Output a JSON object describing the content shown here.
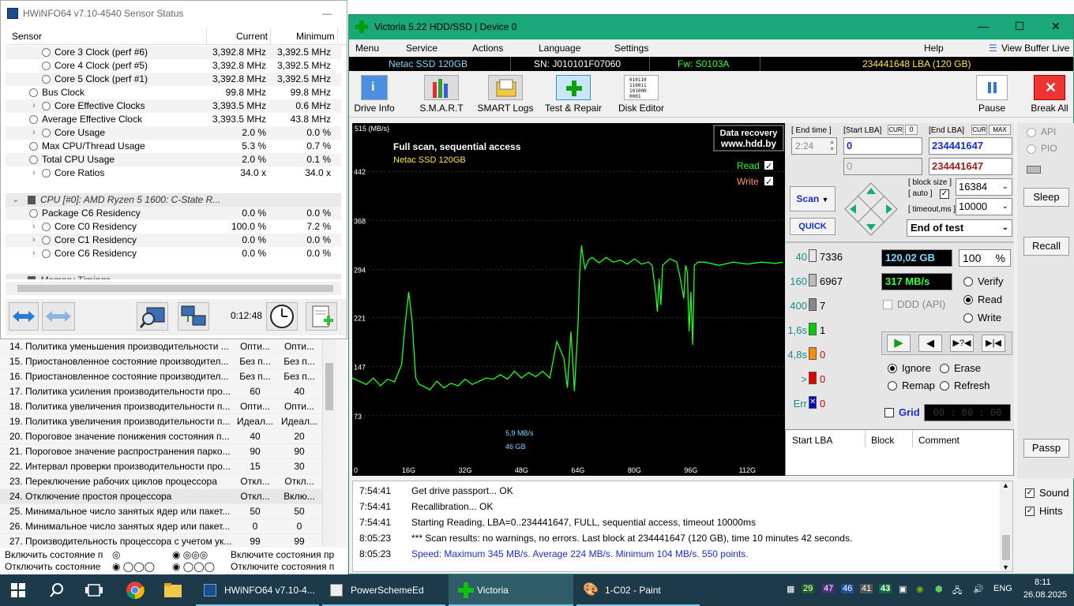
{
  "pse": {
    "rows": [
      {
        "name": "14. Политика уменьшения производительности ...",
        "a": "Опти...",
        "b": "Опти..."
      },
      {
        "name": "15. Приостановленное состояние производител...",
        "a": "Без п...",
        "b": "Без п..."
      },
      {
        "name": "16. Приостановленное состояние производител...",
        "a": "Без п...",
        "b": "Без п..."
      },
      {
        "name": "17. Политика усиления производительности про...",
        "a": "60",
        "b": "40"
      },
      {
        "name": "18. Политика увеличения производительности п...",
        "a": "Опти...",
        "b": "Опти..."
      },
      {
        "name": "19. Политика увеличения производительности п...",
        "a": "Идеал...",
        "b": "Идеал..."
      },
      {
        "name": "20. Пороговое значение понижения состояния п...",
        "a": "40",
        "b": "20"
      },
      {
        "name": "21. Пороговое значение распространения парко...",
        "a": "90",
        "b": "90"
      },
      {
        "name": "22. Интервал проверки производительности про...",
        "a": "15",
        "b": "30"
      },
      {
        "name": "23. Переключение рабочих циклов процессора",
        "a": "Откл...",
        "b": "Откл..."
      },
      {
        "name": "24. Отключение простоя процессора",
        "a": "Откл...",
        "b": "Вклю..."
      },
      {
        "name": "25. Минимальное число занятых ядер или пакет...",
        "a": "50",
        "b": "50"
      },
      {
        "name": "26. Минимальное число занятых ядер или пакет...",
        "a": "0",
        "b": "0"
      },
      {
        "name": "27. Производительность процессора с учетом ук...",
        "a": "99",
        "b": "99"
      }
    ],
    "bottom1_left": "Включить состояние п",
    "bottom1_right": "Включите состояния пр",
    "bottom2_left": "Отключить состояние",
    "bottom2_right": "Отключите состояния п"
  },
  "hwinfo": {
    "title": "HWiNFO64 v7.10-4540 Sensor Status",
    "columns": {
      "sensor": "Sensor",
      "current": "Current",
      "minimum": "Minimum"
    },
    "rows": [
      {
        "label": "Core 3 Clock (perf #6)",
        "cur": "3,392.8 MHz",
        "min": "3,392.5 MHz",
        "indent": 2,
        "exp": false
      },
      {
        "label": "Core 4 Clock (perf #5)",
        "cur": "3,392.8 MHz",
        "min": "3,392.5 MHz",
        "indent": 2,
        "exp": false
      },
      {
        "label": "Core 5 Clock (perf #1)",
        "cur": "3,392.8 MHz",
        "min": "3,392.5 MHz",
        "indent": 2,
        "exp": false
      },
      {
        "label": "Bus Clock",
        "cur": "99.8 MHz",
        "min": "99.8 MHz",
        "indent": 1,
        "exp": false
      },
      {
        "label": "Core Effective Clocks",
        "cur": "3,393.5 MHz",
        "min": "0.6 MHz",
        "indent": 2,
        "exp": true
      },
      {
        "label": "Average Effective Clock",
        "cur": "3,393.5 MHz",
        "min": "43.8 MHz",
        "indent": 1,
        "exp": false
      },
      {
        "label": "Core Usage",
        "cur": "2.0 %",
        "min": "0.0 %",
        "indent": 2,
        "exp": true
      },
      {
        "label": "Max CPU/Thread Usage",
        "cur": "5.3 %",
        "min": "0.7 %",
        "indent": 1,
        "exp": false
      },
      {
        "label": "Total CPU Usage",
        "cur": "2.0 %",
        "min": "0.1 %",
        "indent": 1,
        "exp": false
      },
      {
        "label": "Core Ratios",
        "cur": "34.0 x",
        "min": "34.0 x",
        "indent": 2,
        "exp": true
      },
      {
        "label": "",
        "cur": "",
        "min": "",
        "indent": 0,
        "exp": false,
        "blank": true
      },
      {
        "label": "CPU [#0]: AMD Ryzen 5 1600: C-State R...",
        "cur": "",
        "min": "",
        "indent": 0,
        "exp": false,
        "group": true
      },
      {
        "label": "Package C6 Residency",
        "cur": "0.0 %",
        "min": "0.0 %",
        "indent": 1,
        "exp": false
      },
      {
        "label": "Core C0 Residency",
        "cur": "100.0 %",
        "min": "7.2 %",
        "indent": 2,
        "exp": true
      },
      {
        "label": "Core C1 Residency",
        "cur": "0.0 %",
        "min": "0.0 %",
        "indent": 2,
        "exp": true
      },
      {
        "label": "Core C6 Residency",
        "cur": "0.0 %",
        "min": "0.0 %",
        "indent": 2,
        "exp": true
      },
      {
        "label": "",
        "cur": "",
        "min": "",
        "indent": 0,
        "exp": false,
        "blank": true
      },
      {
        "label": "Memory Timings",
        "cur": "",
        "min": "",
        "indent": 0,
        "exp": false,
        "group": true
      }
    ],
    "timer": "0:12:48"
  },
  "victoria": {
    "title": "Victoria 5.22 HDD/SSD | Device 0",
    "menu": [
      "Menu",
      "Service",
      "Actions",
      "Language",
      "Settings",
      "Help"
    ],
    "view_buffer": "View Buffer Live",
    "info": {
      "model": "Netac SSD 120GB",
      "sn": "SN: J010101F07060",
      "fw": "Fw: S0103A",
      "lba": "234441648 LBA (120 GB)"
    },
    "tools": [
      "Drive Info",
      "S.M.A.R.T",
      "SMART Logs",
      "Test & Repair",
      "Disk Editor"
    ],
    "pause": "Pause",
    "break_all": "Break All",
    "graph": {
      "watermark1": "Data recovery",
      "watermark2": "www.hdd.by",
      "title": "Full scan, sequential access",
      "model": "Netac SSD 120GB",
      "read": "Read",
      "write": "Write",
      "ylabel": "515 (MB/s)",
      "cursor_speed": "5,9 MB/s",
      "cursor_pos": "46 GB"
    },
    "panel": {
      "end_time_label": "[ End time ]",
      "end_time": "2:24",
      "start_lba_label": "[Start LBA]",
      "cur": "CUR",
      "cur_val": "0",
      "end_lba_label": "[End LBA]",
      "max": "MAX",
      "start_lba": "0",
      "end_lba": "234441647",
      "start_lba2": "0",
      "end_lba2": "234441647",
      "scan": "Scan",
      "quick": "QUICK",
      "block_size_label": "[ block size ]",
      "auto_label": "[ auto ]",
      "block_size": "16384",
      "timeout_label": "[ timeout,ms ]",
      "timeout": "10000",
      "end_action": "End of test",
      "capacity": "120,02 GB",
      "percent": "100",
      "pct_sign": "%",
      "speed": "317 MB/s",
      "ddd": "DDD (API)",
      "verify": "Verify",
      "read": "Read",
      "write": "Write",
      "ignore": "Ignore",
      "erase": "Erase",
      "remap": "Remap",
      "refresh": "Refresh",
      "grid": "Grid",
      "grid_time": "00 : 00 : 00",
      "blocks": [
        {
          "label": "40",
          "count": "7336",
          "color": "#e8e8e8"
        },
        {
          "label": "160",
          "count": "6967",
          "color": "#bcbcbc"
        },
        {
          "label": "400",
          "count": "7",
          "color": "#888888"
        },
        {
          "label": "1,6s",
          "count": "1",
          "color": "#00d000"
        },
        {
          "label": "4,8s",
          "count": "0",
          "color": "#ff8c00"
        },
        {
          "label": ">",
          "count": "0",
          "color": "#e00000"
        },
        {
          "label": "Err",
          "count": "0",
          "color": "#0000c0"
        }
      ],
      "tbl_start": "Start LBA",
      "tbl_block": "Block",
      "tbl_comment": "Comment"
    },
    "side": {
      "api": "API",
      "pio": "PIO",
      "sleep": "Sleep",
      "recall": "Recall",
      "passp": "Passp",
      "sound": "Sound",
      "hints": "Hints"
    },
    "log": [
      {
        "time": "7:54:41",
        "text": "Get drive passport... OK",
        "color": "#000"
      },
      {
        "time": "7:54:41",
        "text": "Recallibration... OK",
        "color": "#000"
      },
      {
        "time": "7:54:41",
        "text": "Starting Reading, LBA=0..234441647, FULL, sequential access, timeout 10000ms",
        "color": "#000"
      },
      {
        "time": "8:05:23",
        "text": "*** Scan results: no warnings, no errors. Last block at 234441647 (120 GB), time 10 minutes 42 seconds.",
        "color": "#000"
      },
      {
        "time": "8:05:23",
        "text": "Speed: Maximum 345 MB/s. Average 224 MB/s. Minimum 104 MB/s. 550 points.",
        "color": "#1a2fc9"
      }
    ]
  },
  "chart_data": {
    "type": "line",
    "x_ticks": [
      "0",
      "16G",
      "32G",
      "48G",
      "64G",
      "80G",
      "96G",
      "112G"
    ],
    "y_ticks": [
      "73",
      "147",
      "221",
      "294",
      "368",
      "442"
    ],
    "ylim": [
      0,
      515
    ],
    "xlim": [
      0,
      122
    ],
    "series": [
      {
        "name": "Read",
        "color": "#20ff20",
        "x": [
          0,
          2,
          4,
          6,
          8,
          10,
          12,
          14,
          15,
          16,
          17,
          18,
          19,
          20,
          22,
          24,
          26,
          28,
          30,
          32,
          34,
          36,
          38,
          40,
          42,
          44,
          46,
          48,
          50,
          52,
          54,
          56,
          58,
          60,
          61,
          62,
          63,
          64,
          64.5,
          65,
          65.5,
          66,
          67,
          68,
          70,
          72,
          74,
          76,
          78,
          80,
          82,
          84,
          85,
          86,
          86.5,
          87,
          87.5,
          88,
          90,
          92,
          93,
          94,
          94.5,
          95,
          95.5,
          96,
          96.5,
          97,
          98,
          100,
          104,
          108,
          112,
          116,
          120,
          122
        ],
        "y": [
          130,
          125,
          120,
          130,
          118,
          128,
          124,
          150,
          210,
          260,
          215,
          130,
          120,
          118,
          112,
          125,
          115,
          122,
          118,
          128,
          120,
          125,
          130,
          128,
          135,
          128,
          140,
          130,
          138,
          132,
          140,
          130,
          185,
          160,
          115,
          200,
          110,
          210,
          290,
          330,
          310,
          295,
          308,
          312,
          304,
          312,
          305,
          308,
          302,
          310,
          302,
          305,
          300,
          260,
          230,
          280,
          240,
          300,
          310,
          305,
          280,
          250,
          300,
          290,
          200,
          260,
          180,
          300,
          305,
          305,
          300,
          305,
          302,
          305,
          303,
          305
        ]
      }
    ]
  },
  "taskbar": {
    "items": [
      "HWiNFO64 v7.10-4...",
      "PowerSchemeEd",
      "Victoria",
      "1-C02 - Paint"
    ],
    "tray_nums": [
      "29",
      "47",
      "46",
      "41",
      "43"
    ],
    "lang": "ENG",
    "time": "8:11",
    "date": "26.08.2025"
  }
}
